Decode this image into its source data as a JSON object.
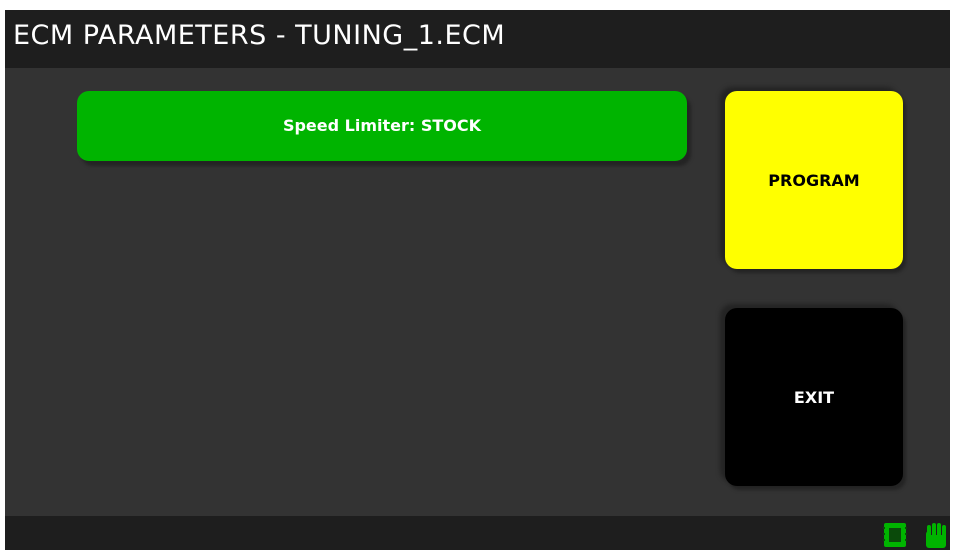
{
  "header": {
    "title": "ECM PARAMETERS - TUNING_1.ECM"
  },
  "parameters": [
    {
      "label": "Speed Limiter: STOCK",
      "color": "#00b400"
    }
  ],
  "actions": {
    "program_label": "PROGRAM",
    "program_color": "#ffff00",
    "exit_label": "EXIT",
    "exit_color": "#000000"
  },
  "status_bar": {
    "icons": [
      "chip-icon",
      "glove-icon"
    ],
    "icon_color": "#00b400"
  }
}
